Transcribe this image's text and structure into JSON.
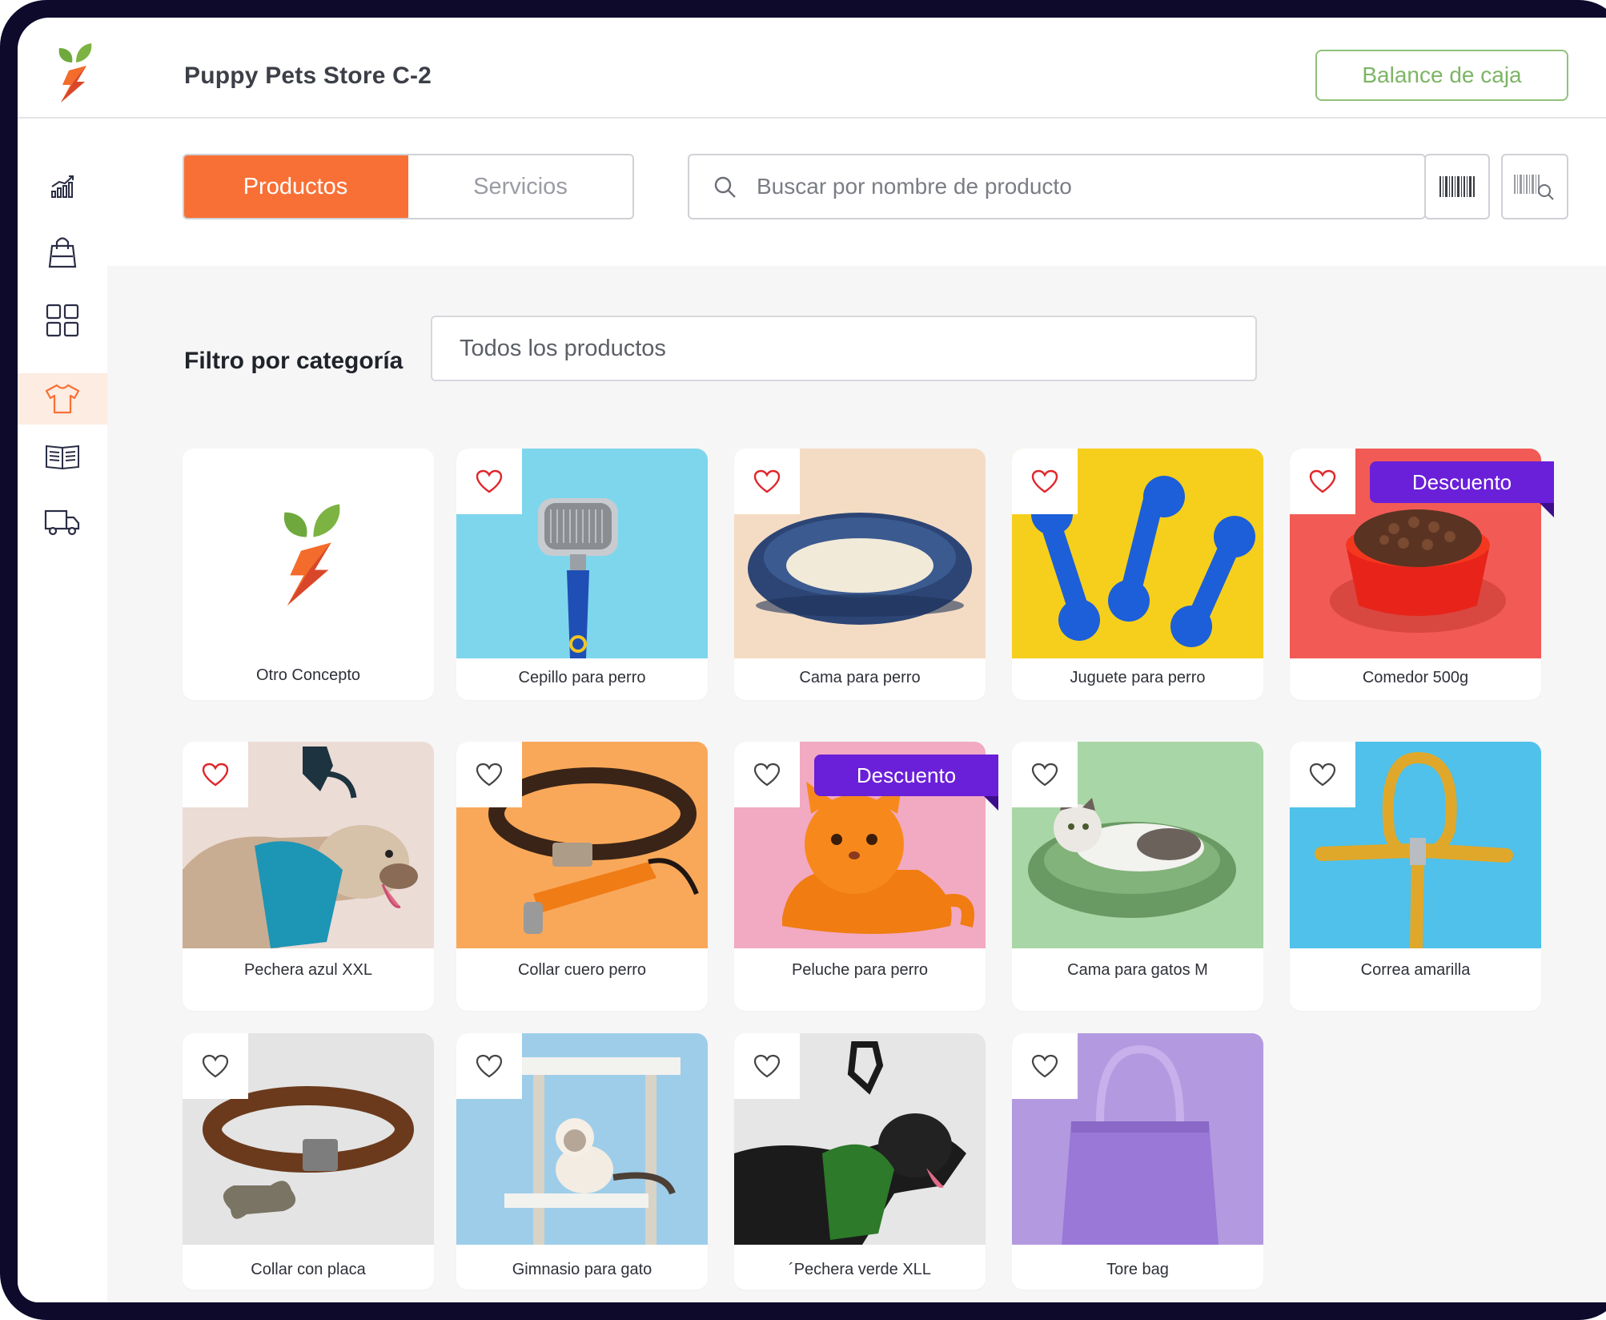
{
  "header": {
    "store_name": "Puppy Pets Store C-2",
    "balance_button": "Balance de caja"
  },
  "sidebar": {
    "items": [
      {
        "icon": "chart-icon",
        "active": false
      },
      {
        "icon": "shopping-bag-icon",
        "active": false
      },
      {
        "icon": "grid-icon",
        "active": false
      },
      {
        "icon": "tshirt-icon",
        "active": true
      },
      {
        "icon": "book-icon",
        "active": false
      },
      {
        "icon": "truck-icon",
        "active": false
      }
    ]
  },
  "tabs": {
    "products": "Productos",
    "services": "Servicios",
    "active": "Productos"
  },
  "search": {
    "placeholder": "Buscar por nombre de producto"
  },
  "filter": {
    "label": "Filtro por categoría",
    "value": "Todos los productos"
  },
  "colors": {
    "accent": "#f97036",
    "balance_green": "#7db565",
    "badge_purple": "#6a1fd8",
    "heart_red": "#e0262b"
  },
  "products": [
    {
      "name": "Otro Concepto",
      "favorite": null,
      "badge": null
    },
    {
      "name": "Cepillo para perro",
      "favorite": true,
      "badge": null
    },
    {
      "name": "Cama para perro",
      "favorite": true,
      "badge": null
    },
    {
      "name": "Juguete para perro",
      "favorite": true,
      "badge": null
    },
    {
      "name": "Comedor 500g",
      "favorite": true,
      "badge": "Descuento"
    },
    {
      "name": "Pechera azul XXL",
      "favorite": true,
      "badge": null
    },
    {
      "name": "Collar cuero perro",
      "favorite": false,
      "badge": null
    },
    {
      "name": "Peluche para perro",
      "favorite": false,
      "badge": "Descuento"
    },
    {
      "name": "Cama para gatos M",
      "favorite": false,
      "badge": null
    },
    {
      "name": "Correa amarilla",
      "favorite": false,
      "badge": null
    },
    {
      "name": "Collar con placa",
      "favorite": false,
      "badge": null
    },
    {
      "name": "Gimnasio para gato",
      "favorite": false,
      "badge": null
    },
    {
      "name": "´Pechera verde XLL",
      "favorite": false,
      "badge": null
    },
    {
      "name": "Tore bag",
      "favorite": false,
      "badge": null
    }
  ]
}
